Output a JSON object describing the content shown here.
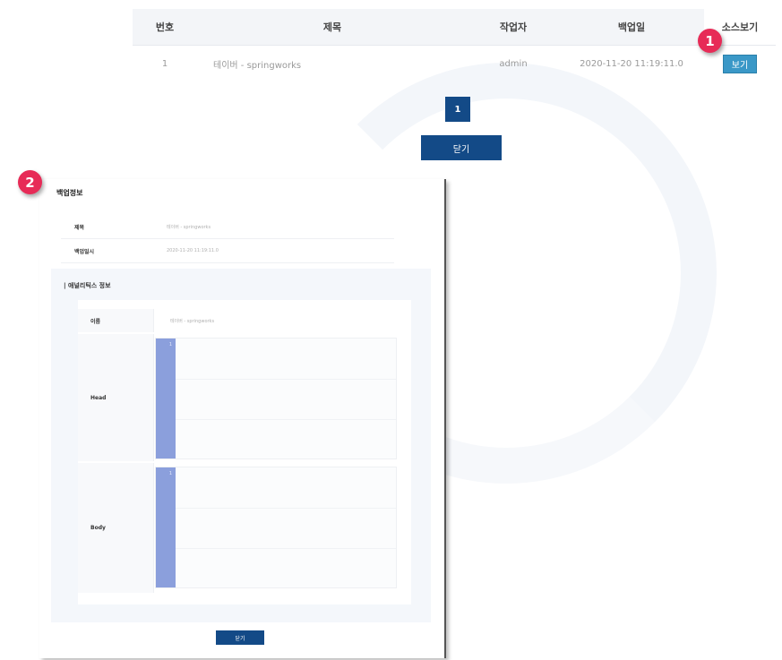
{
  "table": {
    "headers": [
      "번호",
      "제목",
      "작업자",
      "백업일",
      "소스보기"
    ],
    "rows": [
      {
        "no": "1",
        "title": "테이버 - springworks",
        "worker": "admin",
        "date": "2020-11-20 11:19:11.0",
        "action": "보기"
      }
    ]
  },
  "badges": {
    "one": "1",
    "two": "2"
  },
  "pagination": {
    "current": "1"
  },
  "close_button": "닫기",
  "popup": {
    "title": "백업정보",
    "info": [
      {
        "label": "제목",
        "value": "테이버 - springworks"
      },
      {
        "label": "백업일시",
        "value": "2020-11-20 11:19:11.0"
      }
    ],
    "section_title": "| 애널리틱스 정보",
    "name_label": "이름",
    "name_value": "테이버 - springworks",
    "head_label": "Head",
    "head_line": "1",
    "body_label": "Body",
    "body_line": "1",
    "close": "닫기"
  },
  "colors": {
    "primary": "#134a87",
    "view_button": "#3a98c7",
    "badge": "#e72b57",
    "gutter": "#8b9fdc"
  }
}
